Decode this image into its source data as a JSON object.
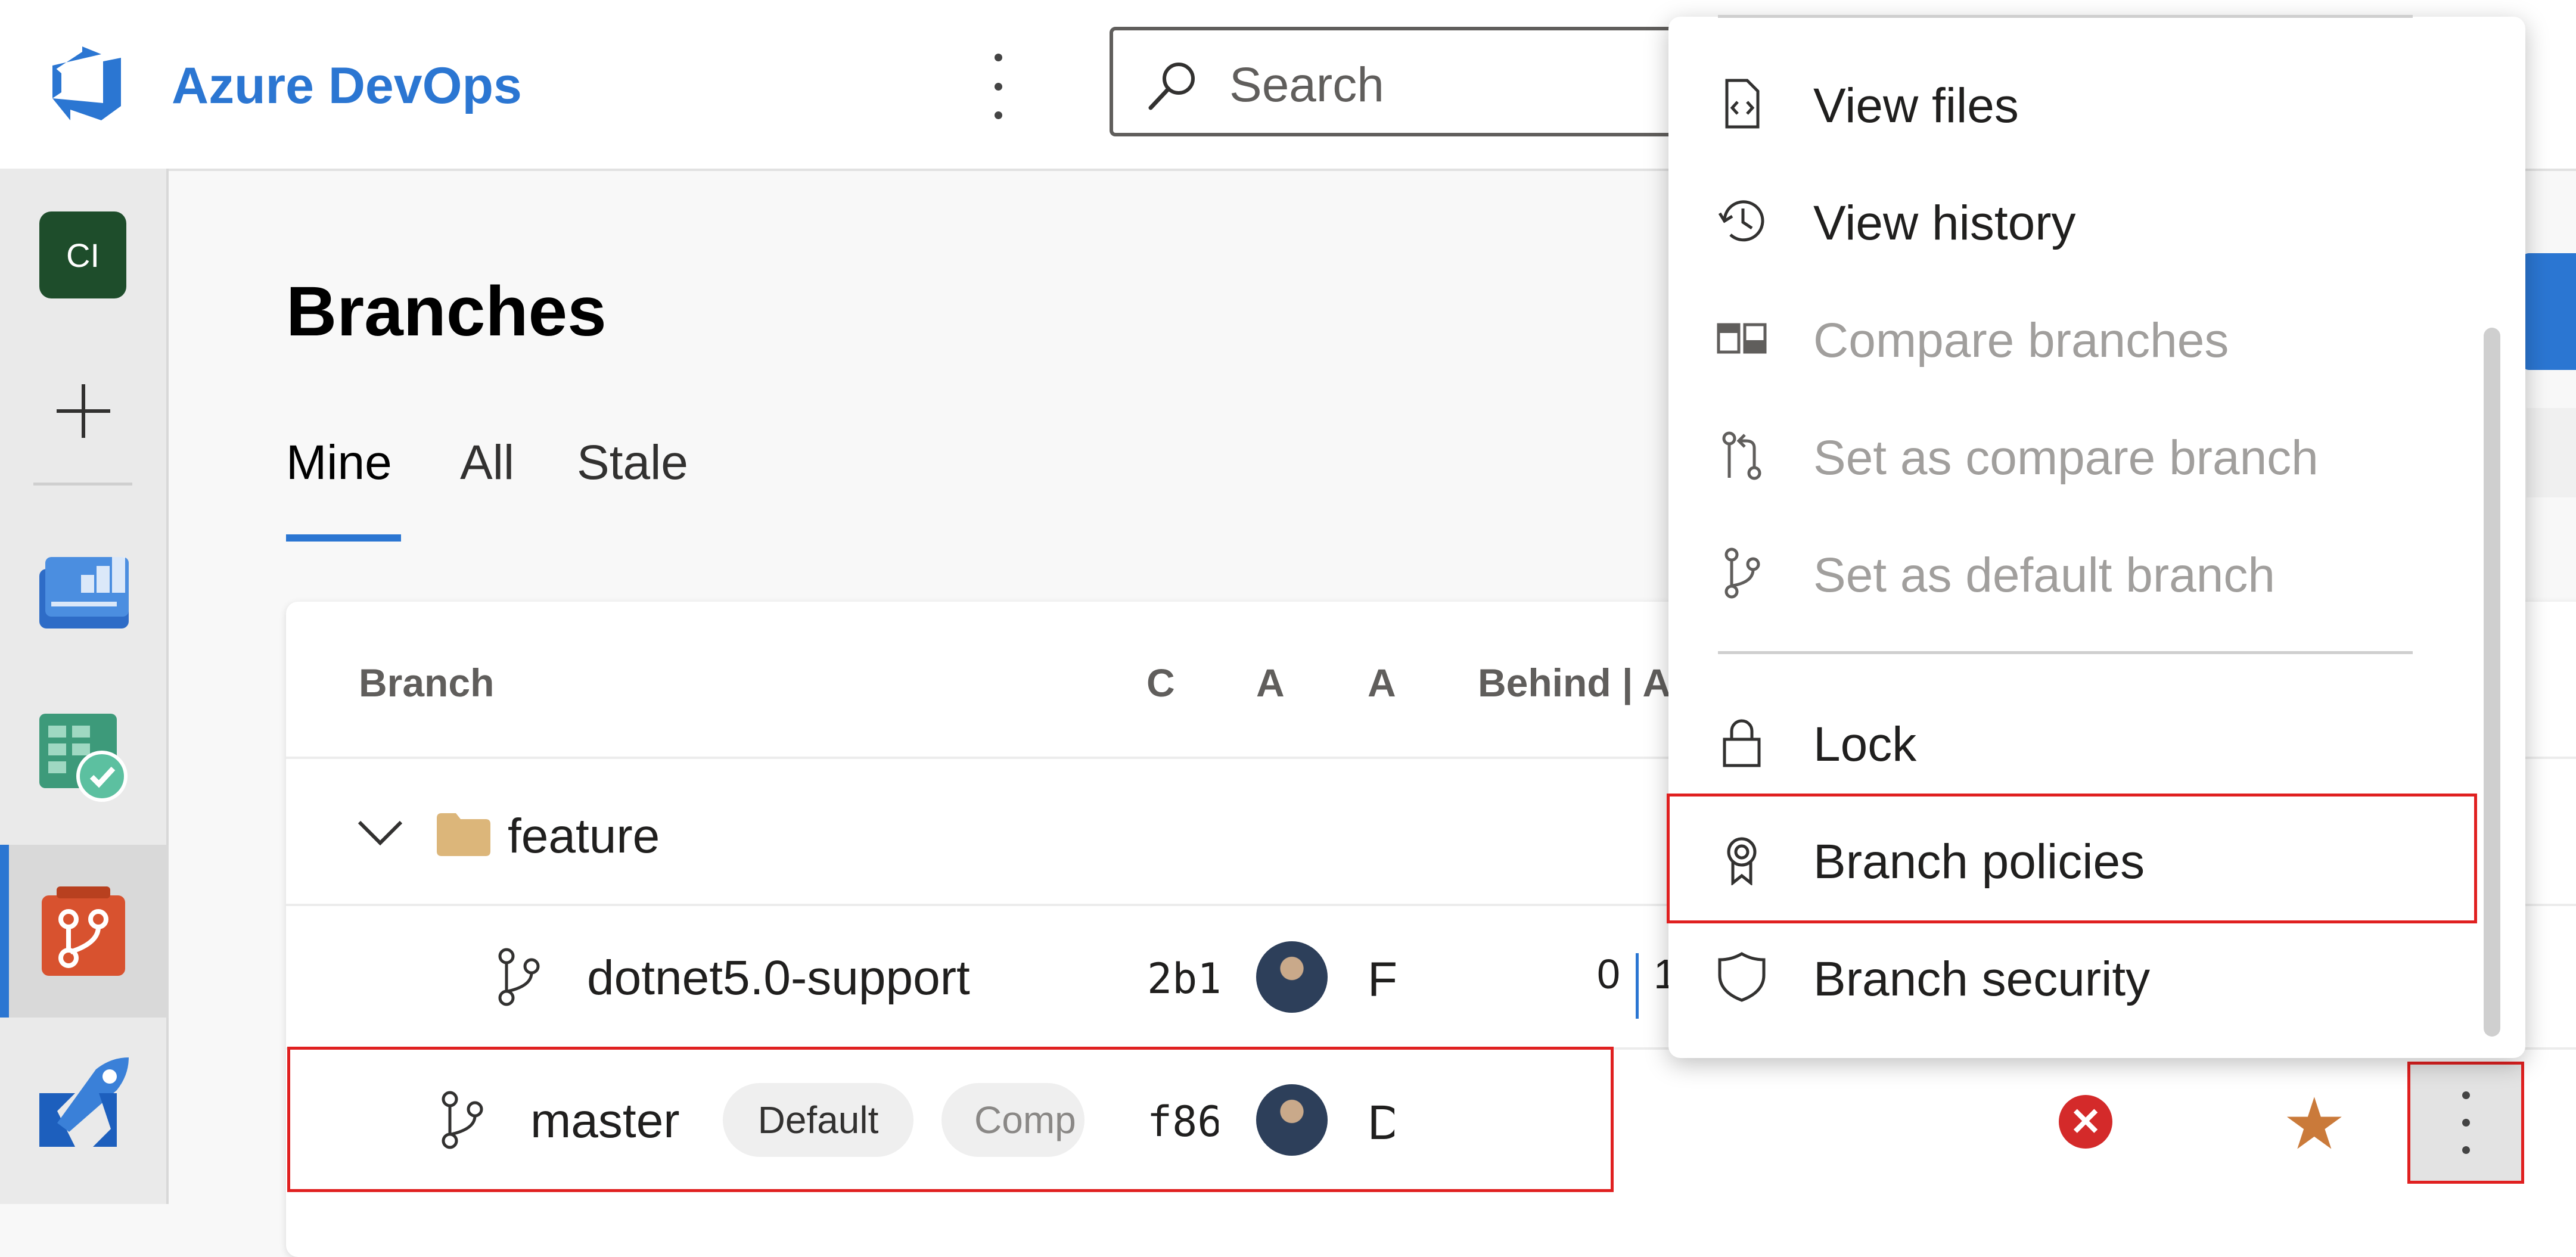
{
  "header": {
    "app_title": "Azure DevOps",
    "search_placeholder": "Search"
  },
  "nav": {
    "project_initials": "CI"
  },
  "page": {
    "title": "Branches",
    "tabs": [
      {
        "label": "Mine",
        "selected": true
      },
      {
        "label": "All",
        "selected": false
      },
      {
        "label": "Stale",
        "selected": false
      }
    ]
  },
  "table": {
    "headers": {
      "branch": "Branch",
      "commit": "C",
      "author": "A",
      "authored": "A",
      "behind_ahead": "Behind | A"
    },
    "folder": {
      "name": "feature"
    },
    "rows": [
      {
        "name": "dotnet5.0-support",
        "commit": "2b1",
        "author_initial": "F",
        "behind": "0",
        "ahead": "1"
      },
      {
        "name": "master",
        "badge_default": "Default",
        "badge_compare": "Comp",
        "commit": "f86",
        "author_initial": "D"
      }
    ]
  },
  "context_menu": {
    "items": [
      {
        "label": "View files",
        "icon": "code-file-icon",
        "enabled": true
      },
      {
        "label": "View history",
        "icon": "history-icon",
        "enabled": true
      },
      {
        "label": "Compare branches",
        "icon": "compare-icon",
        "enabled": false
      },
      {
        "label": "Set as compare branch",
        "icon": "compare-branch-icon",
        "enabled": false
      },
      {
        "label": "Set as default branch",
        "icon": "branch-icon",
        "enabled": false
      },
      {
        "label": "Lock",
        "icon": "lock-icon",
        "enabled": true
      },
      {
        "label": "Branch policies",
        "icon": "policy-badge-icon",
        "enabled": true
      },
      {
        "label": "Branch security",
        "icon": "shield-icon",
        "enabled": true
      }
    ]
  },
  "colors": {
    "accent": "#2b76d2",
    "highlight_border": "#e02020",
    "favorite_star": "#ca7a3a",
    "error": "#d42a2a"
  }
}
